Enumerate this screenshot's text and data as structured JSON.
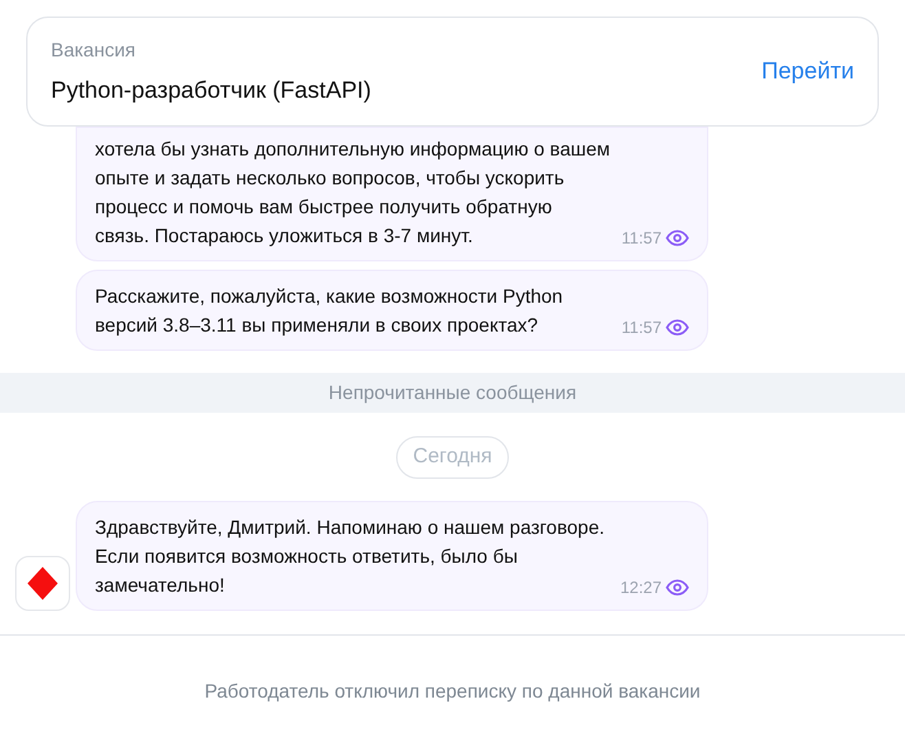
{
  "vacancy": {
    "label": "Вакансия",
    "title": "Python-разработчик (FastAPI)",
    "action": "Перейти"
  },
  "messages_before": [
    {
      "text": "хотела бы узнать дополнительную информацию о вашем опыте и задать несколько вопросов, чтобы ускорить процесс и помочь вам быстрее получить обратную связь. Постараюсь уложиться в 3-7 минут.",
      "time": "11:57",
      "read": true,
      "avatar": false,
      "clipped": true
    },
    {
      "text": "Расскажите, пожалуйста, какие возможности Python версий 3.8–3.11 вы применяли в своих проектах?",
      "time": "11:57",
      "read": true,
      "avatar": false,
      "clipped": false
    }
  ],
  "unread_divider": "Непрочитанные сообщения",
  "date_chip": "Сегодня",
  "messages_after": [
    {
      "text": "Здравствуйте, Дмитрий. Напоминаю о нашем разговоре. Если появится возможность ответить, было бы замечательно!",
      "time": "12:27",
      "read": true,
      "avatar": true,
      "clipped": false
    }
  ],
  "footer_notice": "Работодатель отключил переписку по данной вакансии"
}
